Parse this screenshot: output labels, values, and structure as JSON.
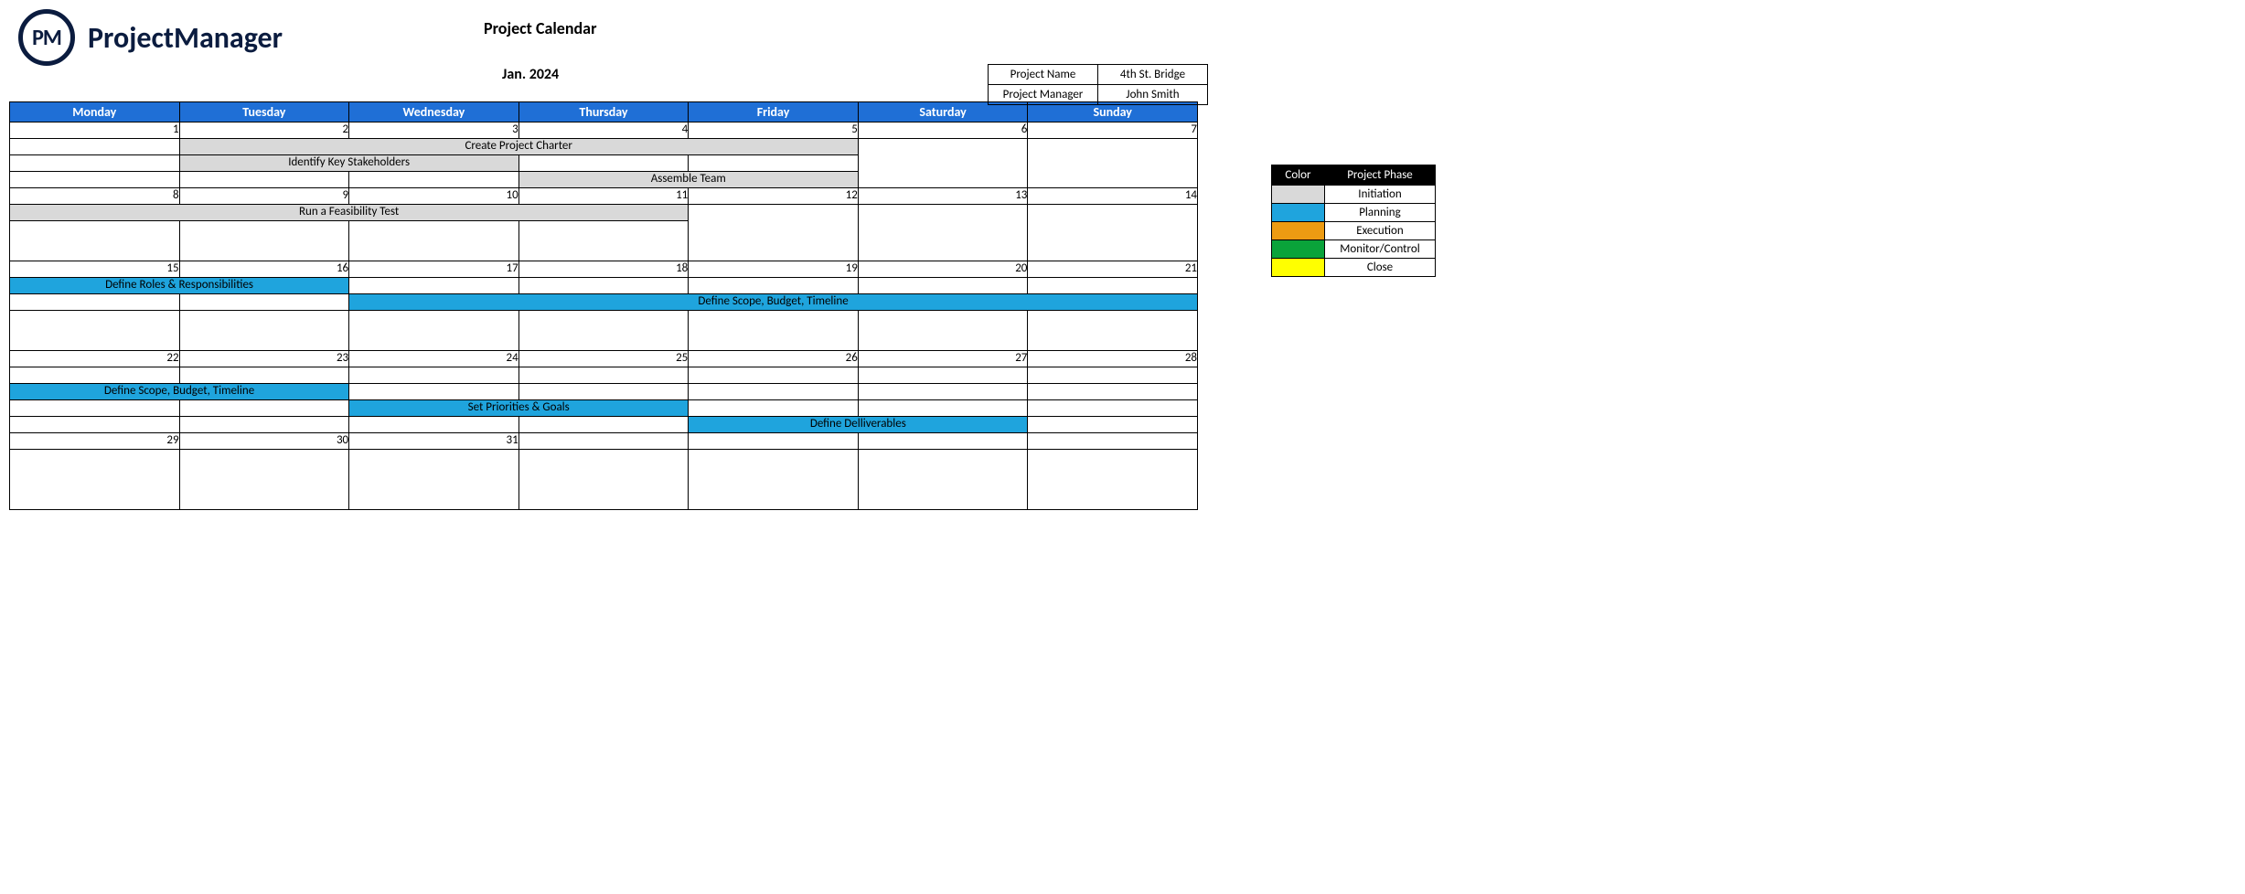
{
  "brand": {
    "logo_initials": "PM",
    "logo_name": "ProjectManager"
  },
  "titles": {
    "main": "Project Calendar",
    "period": "Jan. 2024"
  },
  "info": {
    "name_label": "Project Name",
    "name_value": "4th St. Bridge",
    "manager_label": "Project Manager",
    "manager_value": "John Smith"
  },
  "legend": {
    "col_color": "Color",
    "col_phase": "Project Phase",
    "phases": {
      "initiation": "Initiation",
      "planning": "Planning",
      "execution": "Execution",
      "monitor": "Monitor/Control",
      "close": "Close"
    }
  },
  "days": {
    "mon": "Monday",
    "tue": "Tuesday",
    "wed": "Wednesday",
    "thu": "Thursday",
    "fri": "Friday",
    "sat": "Saturday",
    "sun": "Sunday"
  },
  "dates": {
    "w1": [
      "1",
      "2",
      "3",
      "4",
      "5",
      "6",
      "7"
    ],
    "w2": [
      "8",
      "9",
      "10",
      "11",
      "12",
      "13",
      "14"
    ],
    "w3": [
      "15",
      "16",
      "17",
      "18",
      "19",
      "20",
      "21"
    ],
    "w4": [
      "22",
      "23",
      "24",
      "25",
      "26",
      "27",
      "28"
    ],
    "w5": [
      "29",
      "30",
      "31"
    ]
  },
  "tasks": {
    "charter": "Create Project Charter",
    "stakeholders": "Identify Key Stakeholders",
    "assemble": "Assemble Team",
    "feasibility": "Run a Feasibility Test",
    "roles": "Define Roles & Responsibilities",
    "scope": "Define Scope, Budget, Timeline",
    "scope2": "Define Scope, Budget, Timeline",
    "priorities": "Set Priorities & Goals",
    "deliverables": "Define Delliverables"
  }
}
